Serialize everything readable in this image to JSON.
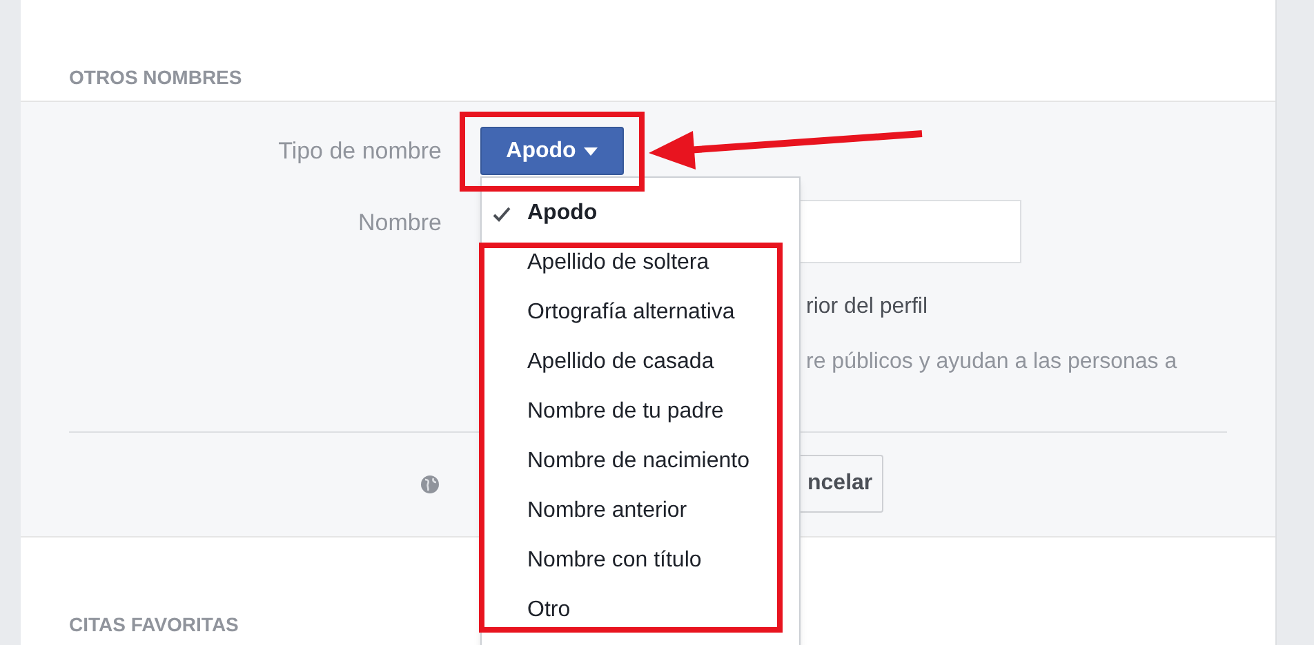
{
  "section_title": "OTROS NOMBRES",
  "form": {
    "name_type": {
      "label": "Tipo de nombre",
      "button": "Apodo"
    },
    "name": {
      "label": "Nombre"
    },
    "hint_1": "rior del perfil",
    "hint_2": "re públicos y ayudan a las personas a",
    "cancel_button": "ncelar"
  },
  "dropdown": {
    "items": [
      {
        "label": "Apodo",
        "selected": true
      },
      {
        "label": "Apellido de soltera",
        "selected": false
      },
      {
        "label": "Ortografía alternativa",
        "selected": false
      },
      {
        "label": "Apellido de casada",
        "selected": false
      },
      {
        "label": "Nombre de tu padre",
        "selected": false
      },
      {
        "label": "Nombre de nacimiento",
        "selected": false
      },
      {
        "label": "Nombre anterior",
        "selected": false
      },
      {
        "label": "Nombre con título",
        "selected": false
      },
      {
        "label": "Otro",
        "selected": false
      }
    ]
  },
  "next_section_title": "CITAS FAVORITAS"
}
